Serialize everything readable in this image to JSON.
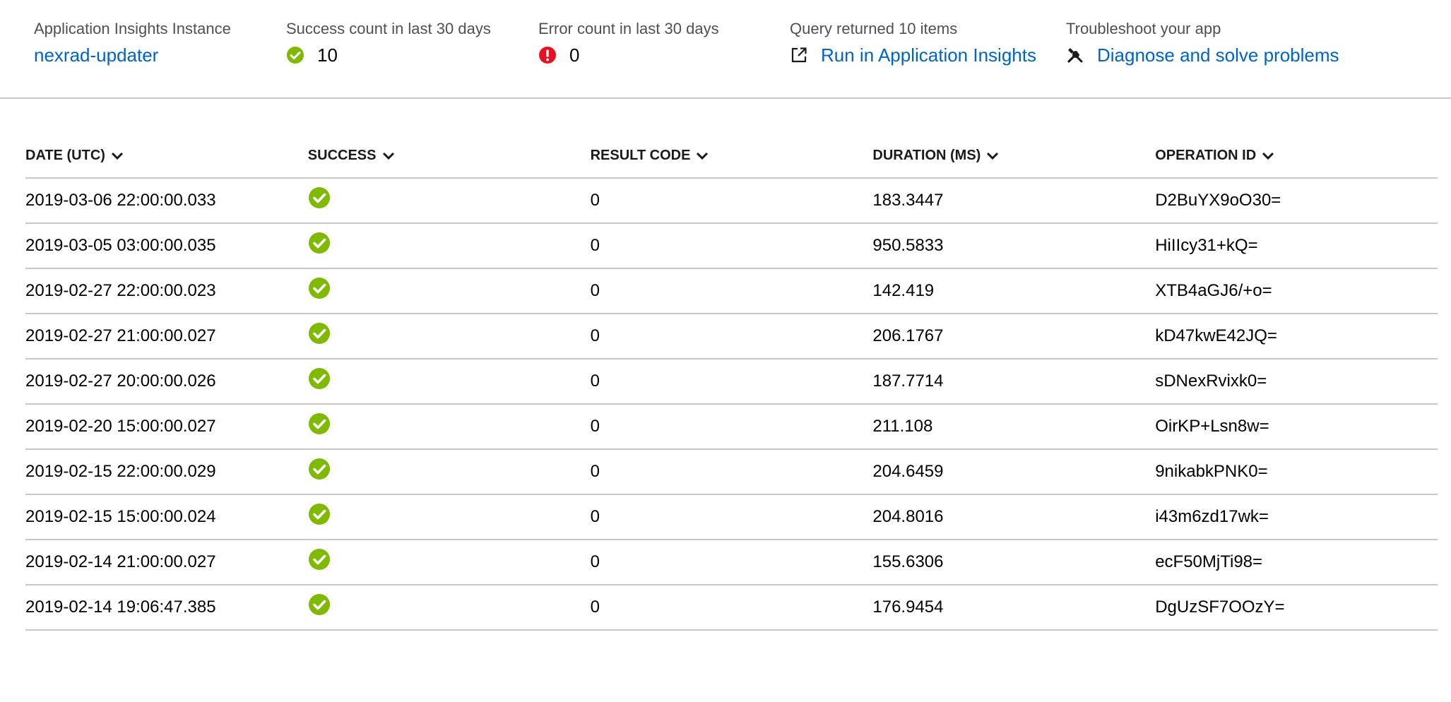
{
  "summary": {
    "instance": {
      "label": "Application Insights Instance",
      "value": "nexrad-updater"
    },
    "success": {
      "label": "Success count in last 30 days",
      "value": "10",
      "icon": "success-check-icon",
      "color": "#7fba00"
    },
    "error": {
      "label": "Error count in last 30 days",
      "value": "0",
      "icon": "error-exclamation-icon",
      "color": "#e81123"
    },
    "query": {
      "label": "Query returned 10 items",
      "link": "Run in Application Insights",
      "icon": "external-link-icon"
    },
    "troubleshoot": {
      "label": "Troubleshoot your app",
      "link": "Diagnose and solve problems",
      "icon": "wrench-screwdriver-icon"
    }
  },
  "table": {
    "columns": [
      "DATE (UTC)",
      "SUCCESS",
      "RESULT CODE",
      "DURATION (MS)",
      "OPERATION ID"
    ],
    "rows": [
      {
        "date": "2019-03-06 22:00:00.033",
        "success": true,
        "result_code": "0",
        "duration": "183.3447",
        "operation_id": "D2BuYX9oO30="
      },
      {
        "date": "2019-03-05 03:00:00.035",
        "success": true,
        "result_code": "0",
        "duration": "950.5833",
        "operation_id": "HiIIcy31+kQ="
      },
      {
        "date": "2019-02-27 22:00:00.023",
        "success": true,
        "result_code": "0",
        "duration": "142.419",
        "operation_id": "XTB4aGJ6/+o="
      },
      {
        "date": "2019-02-27 21:00:00.027",
        "success": true,
        "result_code": "0",
        "duration": "206.1767",
        "operation_id": "kD47kwE42JQ="
      },
      {
        "date": "2019-02-27 20:00:00.026",
        "success": true,
        "result_code": "0",
        "duration": "187.7714",
        "operation_id": "sDNexRvixk0="
      },
      {
        "date": "2019-02-20 15:00:00.027",
        "success": true,
        "result_code": "0",
        "duration": "211.108",
        "operation_id": "OirKP+Lsn8w="
      },
      {
        "date": "2019-02-15 22:00:00.029",
        "success": true,
        "result_code": "0",
        "duration": "204.6459",
        "operation_id": "9nikabkPNK0="
      },
      {
        "date": "2019-02-15 15:00:00.024",
        "success": true,
        "result_code": "0",
        "duration": "204.8016",
        "operation_id": "i43m6zd17wk="
      },
      {
        "date": "2019-02-14 21:00:00.027",
        "success": true,
        "result_code": "0",
        "duration": "155.6306",
        "operation_id": "ecF50MjTi98="
      },
      {
        "date": "2019-02-14 19:06:47.385",
        "success": true,
        "result_code": "0",
        "duration": "176.9454",
        "operation_id": "DgUzSF7OOzY="
      }
    ],
    "success_icon": "success-check-icon",
    "sort_icon": "chevron-down-icon"
  }
}
